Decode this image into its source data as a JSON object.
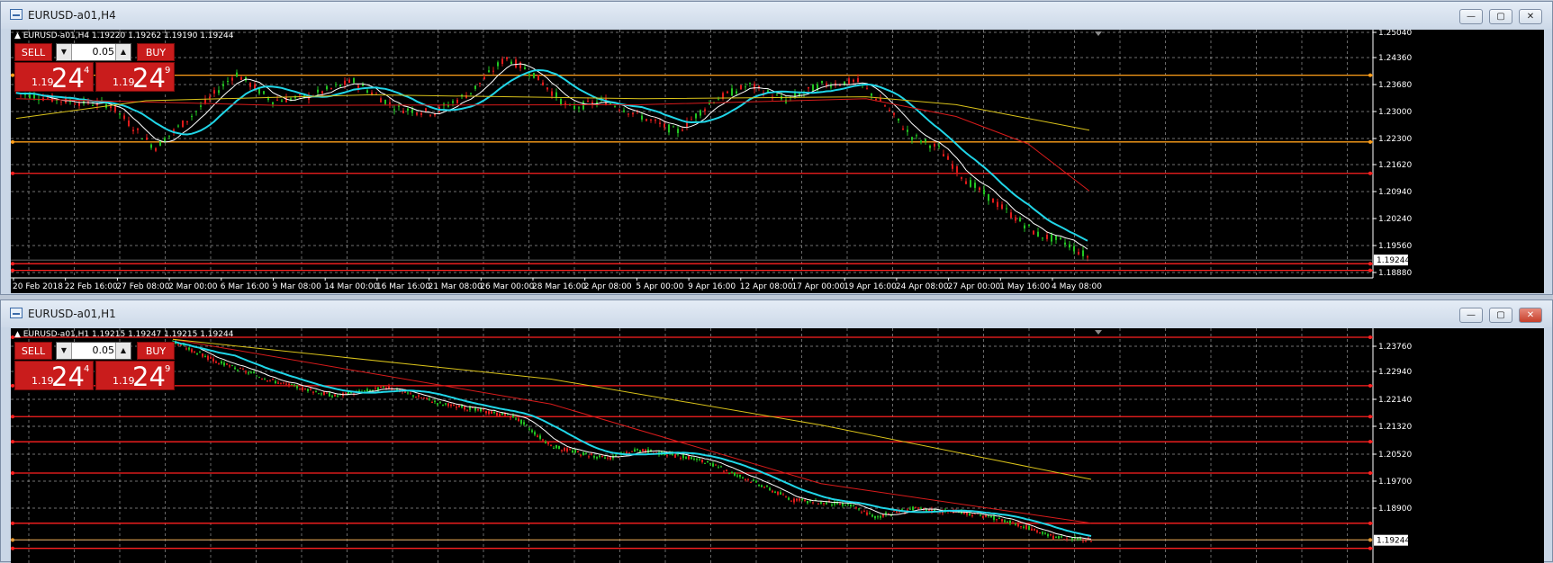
{
  "windows": [
    {
      "title": "EURUSD-a01,H4",
      "info": "EURUSD-a01,H4  1.19220 1.19262 1.19190 1.19244",
      "trade": {
        "sell": "SELL",
        "buy": "BUY",
        "lot": "0.05",
        "sell_small": "1.19",
        "sell_big": "24",
        "sell_sup": "4",
        "buy_small": "1.19",
        "buy_big": "24",
        "buy_sup": "9"
      },
      "price_labels": [
        "1.25040",
        "1.24360",
        "1.23680",
        "1.23000",
        "1.22300",
        "1.21620",
        "1.20940",
        "1.20240",
        "1.19560",
        "1.18880"
      ],
      "current_price": "1.19244",
      "time_labels": [
        "20 Feb 2018",
        "22 Feb 16:00",
        "27 Feb 08:00",
        "2 Mar 00:00",
        "6 Mar 16:00",
        "9 Mar 08:00",
        "14 Mar 00:00",
        "16 Mar 16:00",
        "21 Mar 08:00",
        "26 Mar 00:00",
        "28 Mar 16:00",
        "2 Apr 08:00",
        "5 Apr 00:00",
        "9 Apr 16:00",
        "12 Apr 08:00",
        "17 Apr 00:00",
        "19 Apr 16:00",
        "24 Apr 08:00",
        "27 Apr 00:00",
        "1 May 16:00",
        "4 May 08:00"
      ],
      "horizontal_lines": [
        {
          "price": 1.2395,
          "color": "#ff9f1a"
        },
        {
          "price": 1.2225,
          "color": "#ff9f1a"
        },
        {
          "price": 1.2145,
          "color": "#ff2020"
        },
        {
          "price": 1.1915,
          "color": "#ff2020"
        },
        {
          "price": 1.1898,
          "color": "#ff2020"
        }
      ]
    },
    {
      "title": "EURUSD-a01,H1",
      "info": "EURUSD-a01,H1  1.19215 1.19247 1.19215 1.19244",
      "trade": {
        "sell": "SELL",
        "buy": "BUY",
        "lot": "0.05",
        "sell_small": "1.19",
        "sell_big": "24",
        "sell_sup": "4",
        "buy_small": "1.19",
        "buy_big": "24",
        "buy_sup": "9"
      },
      "price_labels": [
        "1.23760",
        "1.22940",
        "1.22140",
        "1.21320",
        "1.20520",
        "1.19700",
        "1.18900"
      ],
      "current_price": "1.19244",
      "time_labels": [],
      "horizontal_lines": [
        {
          "price": 1.241,
          "color": "#ff2020"
        },
        {
          "price": 1.2294,
          "color": "#ff2020"
        },
        {
          "price": 1.222,
          "color": "#ff2020"
        },
        {
          "price": 1.216,
          "color": "#ff2020"
        },
        {
          "price": 1.2085,
          "color": "#ff2020"
        },
        {
          "price": 1.1965,
          "color": "#ff2020"
        },
        {
          "price": 1.1925,
          "color": "#ff9f1a"
        },
        {
          "price": 1.1905,
          "color": "#ff2020"
        }
      ]
    }
  ],
  "colors": {
    "bull": "#22c522",
    "bear": "#e01b1b",
    "ma_fast": "#ffffff",
    "ma_mid": "#20d6e8",
    "ma_slow": "#d81b1b",
    "ma_long": "#d9c21a",
    "grid": "#c8c8c8"
  }
}
